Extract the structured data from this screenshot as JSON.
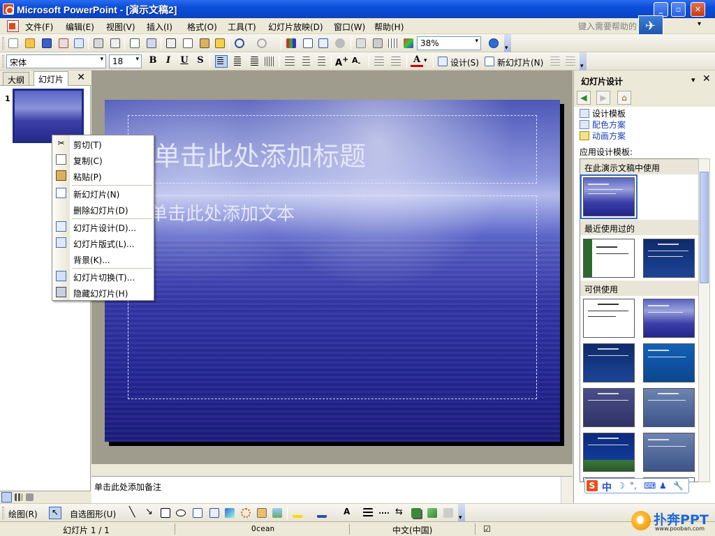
{
  "window": {
    "title": "Microsoft PowerPoint - [演示文稿2]",
    "buttons": {
      "minimize": "_",
      "maximize": "▫",
      "close": "✕"
    }
  },
  "menubar": {
    "items": [
      "文件(F)",
      "编辑(E)",
      "视图(V)",
      "插入(I)",
      "格式(O)",
      "工具(T)",
      "幻灯片放映(D)",
      "窗口(W)",
      "帮助(H)"
    ],
    "help_placeholder": "键入需要帮助的",
    "help_dropdown": "▾"
  },
  "standard_toolbar": {
    "zoom": "38%",
    "help_icon": "help-icon"
  },
  "formatting_toolbar": {
    "font_name": "宋体",
    "font_size": "18",
    "bold": "B",
    "italic": "I",
    "underline": "U",
    "shadow": "S",
    "font_color": "A",
    "design_label": "设计(S)",
    "new_slide_label": "新幻灯片(N)"
  },
  "outline_pane": {
    "tab_outline": "大纲",
    "tab_slides": "幻灯片",
    "close": "✕",
    "slide_number": "1"
  },
  "slide": {
    "title_placeholder": "单击此处添加标题",
    "body_placeholder": "单击此处添加文本"
  },
  "notes": {
    "placeholder": "单击此处添加备注"
  },
  "context_menu": {
    "items": [
      {
        "label": "剪切(T)",
        "icon": "scissors-icon"
      },
      {
        "label": "复制(C)",
        "icon": "copy-icon"
      },
      {
        "label": "粘贴(P)",
        "icon": "paste-icon"
      },
      {
        "label": "新幻灯片(N)",
        "icon": "new-slide-icon"
      },
      {
        "label": "删除幻灯片(D)",
        "icon": ""
      },
      {
        "label": "幻灯片设计(D)...",
        "icon": "slide-design-icon"
      },
      {
        "label": "幻灯片版式(L)...",
        "icon": "slide-layout-icon"
      },
      {
        "label": "背景(K)...",
        "icon": ""
      },
      {
        "label": "幻灯片切换(T)...",
        "icon": "slide-transition-icon"
      },
      {
        "label": "隐藏幻灯片(H)",
        "icon": "hide-slide-icon"
      }
    ]
  },
  "task_pane": {
    "title": "幻灯片设计",
    "dropdown": "▾",
    "close": "✕",
    "links": [
      "设计模板",
      "配色方案",
      "动画方案"
    ],
    "apply_label": "应用设计模板:",
    "sections": [
      "在此演示文稿中使用",
      "最近使用过的",
      "可供使用"
    ]
  },
  "drawing_toolbar": {
    "draw_label": "绘图(R)",
    "autoshapes_label": "自选图形(U)"
  },
  "statusbar": {
    "slide_info": "幻灯片 1 / 1",
    "design_name": "Ocean",
    "language": "中文(中国)"
  },
  "ime": {
    "logo": "S",
    "mode": "中",
    "symbols": [
      "☽",
      "°,",
      "⌨",
      "♟",
      "🔧"
    ]
  },
  "watermark": {
    "brand": "扑奔PPT",
    "url": "www.pooban.com"
  },
  "colors": {
    "titlebar": "#0b4fd8",
    "accent_link": "#1b3fb8",
    "slide_dark": "#1c1d7f"
  }
}
